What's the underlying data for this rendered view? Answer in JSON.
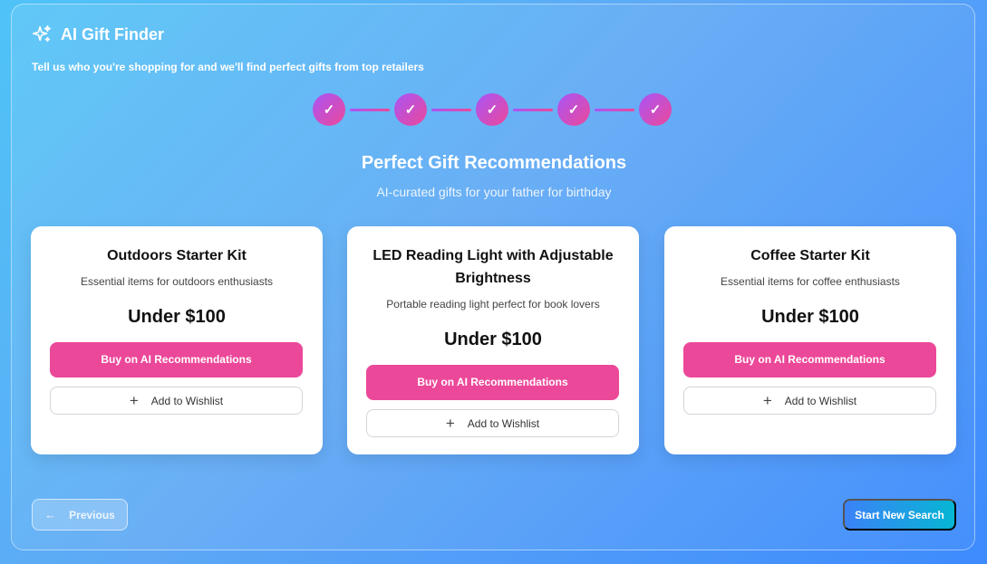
{
  "app": {
    "title": "AI Gift Finder",
    "icon": "sparkles-icon"
  },
  "tagline": "Tell us who you're shopping for and we'll find perfect gifts from top retailers",
  "stepper": {
    "steps": [
      "✓",
      "✓",
      "✓",
      "✓",
      "✓"
    ],
    "completed": 5,
    "total": 5
  },
  "results": {
    "title": "Perfect Gift Recommendations",
    "subtitle": "AI-curated gifts for your father for birthday"
  },
  "cards": [
    {
      "name": "Outdoors Starter Kit",
      "description": "Essential items for outdoors enthusiasts",
      "price": "Under $100",
      "buy_label": "Buy on AI Recommendations",
      "wishlist_label": "Add to Wishlist"
    },
    {
      "name": "LED Reading Light with Adjustable Brightness",
      "description": "Portable reading light perfect for book lovers",
      "price": "Under $100",
      "buy_label": "Buy on AI Recommendations",
      "wishlist_label": "Add to Wishlist"
    },
    {
      "name": "Coffee Starter Kit",
      "description": "Essential items for coffee enthusiasts",
      "price": "Under $100",
      "buy_label": "Buy on AI Recommendations",
      "wishlist_label": "Add to Wishlist"
    }
  ],
  "nav": {
    "previous_label": "Previous",
    "new_search_label": "Start New Search"
  },
  "colors": {
    "accent_pink": "#ec4899",
    "step_gradient_start": "#a855f7",
    "new_search_start": "#3b82f6",
    "new_search_end": "#06b6d4"
  }
}
